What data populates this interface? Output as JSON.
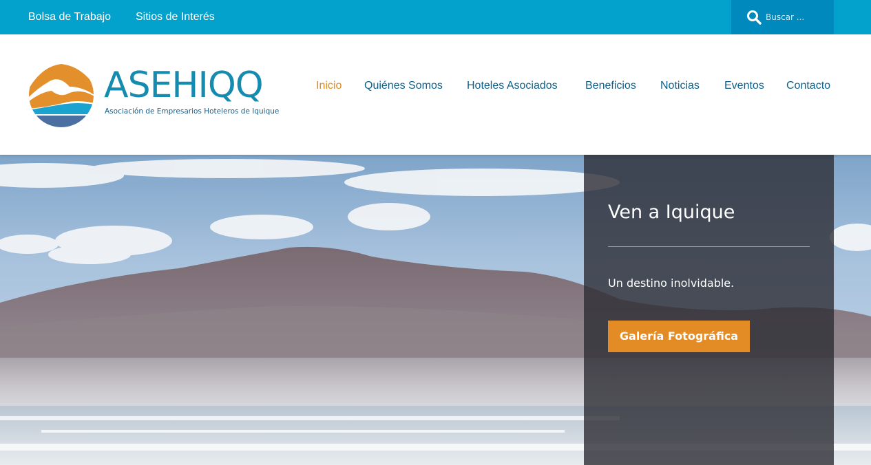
{
  "topbar": {
    "links": [
      "Bolsa de Trabajo",
      "Sitios de Interés"
    ],
    "search": {
      "placeholder": "Buscar ...",
      "value": "",
      "icon": "search-icon"
    }
  },
  "header": {
    "logo": {
      "wordmark": "ASEHIQQ",
      "subtitle": "Asociación de Empresarios Hoteleros de Iquique"
    },
    "nav": [
      "Inicio",
      "Quiénes Somos",
      "Hoteles Asociados",
      "Beneficios",
      "Noticias",
      "Eventos",
      "Contacto"
    ],
    "active_nav": "Inicio"
  },
  "hero": {
    "title": "Ven a Iquique",
    "text": "Un destino inolvidable.",
    "button_label": "Galería Fotográfica"
  },
  "colors": {
    "topbar": "#02a2cc",
    "search_bg": "#0089bd",
    "nav_text": "#0d5f8a",
    "nav_active": "#e0891c",
    "accent_button": "#e38b24",
    "logo_blue": "#168bb0"
  }
}
